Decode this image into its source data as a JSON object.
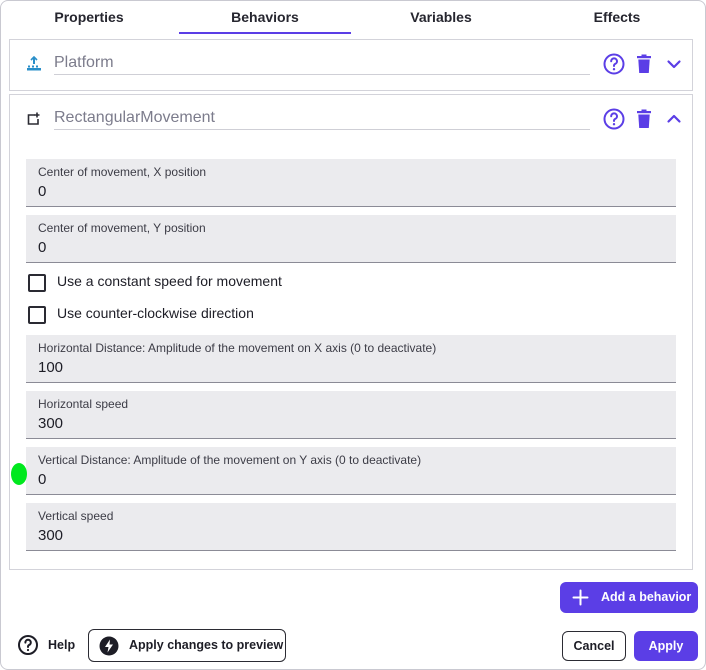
{
  "tabs": [
    {
      "label": "Properties"
    },
    {
      "label": "Behaviors"
    },
    {
      "label": "Variables"
    },
    {
      "label": "Effects"
    }
  ],
  "active_tab": "Behaviors",
  "behaviors": {
    "platform": {
      "name": "Platform",
      "icon": "platform-icon",
      "expanded": false
    },
    "rectangular": {
      "name": "RectangularMovement",
      "icon": "rectangular-movement-icon",
      "expanded": true,
      "fields": {
        "center_x": {
          "label": "Center of movement, X position",
          "value": "0"
        },
        "center_y": {
          "label": "Center of movement, Y position",
          "value": "0"
        },
        "h_distance": {
          "label": "Horizontal Distance: Amplitude of the movement on X axis (0 to deactivate)",
          "value": "100"
        },
        "h_speed": {
          "label": "Horizontal speed",
          "value": "300"
        },
        "v_distance": {
          "label": "Vertical Distance: Amplitude of the movement on Y axis (0 to deactivate)",
          "value": "0"
        },
        "v_speed": {
          "label": "Vertical speed",
          "value": "300"
        }
      },
      "checkboxes": {
        "constant_speed": {
          "label": "Use a constant speed for movement",
          "checked": false
        },
        "ccw": {
          "label": "Use counter-clockwise direction",
          "checked": false
        }
      }
    }
  },
  "buttons": {
    "add_behavior": "Add a behavior",
    "help": "Help",
    "apply_preview": "Apply changes to preview",
    "cancel": "Cancel",
    "apply": "Apply"
  },
  "colors": {
    "accent": "#5b3ee6",
    "platform_icon": "#2a8fc9",
    "cursor": "#00e81e"
  }
}
